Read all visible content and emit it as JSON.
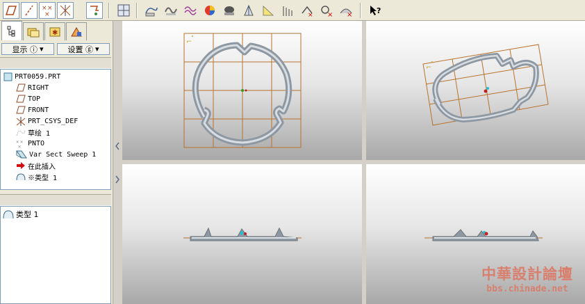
{
  "toolbar": {
    "icons": [
      "datum-plane-toggle-icon",
      "datum-axis-toggle-icon",
      "datum-point-toggle-icon",
      "csys-toggle-icon",
      "annotation-toggle-icon",
      "view-manager-icon",
      "sketch-icon",
      "style-icon",
      "curve-icon",
      "appearance-icon",
      "shading-icon",
      "draft-icon",
      "ruler-icon",
      "cross-section-icon",
      "measure-icon",
      "analysis-icon",
      "whats-this-icon"
    ]
  },
  "left_panel": {
    "show_menu": "显示 ⓘ",
    "settings_menu": "设置 ⓖ",
    "tree": [
      {
        "label": "PRT0059.PRT",
        "icon": "part-icon",
        "indent": 0
      },
      {
        "label": "RIGHT",
        "icon": "datum-plane-icon",
        "indent": 1
      },
      {
        "label": "TOP",
        "icon": "datum-plane-icon",
        "indent": 1
      },
      {
        "label": "FRONT",
        "icon": "datum-plane-icon",
        "indent": 1
      },
      {
        "label": "PRT_CSYS_DEF",
        "icon": "csys-icon",
        "indent": 1
      },
      {
        "label": "草绘 1",
        "icon": "sketch-icon",
        "indent": 1
      },
      {
        "label": "PNTO",
        "icon": "datum-point-icon",
        "indent": 1
      },
      {
        "label": "Var Sect Sweep 1",
        "icon": "sweep-icon",
        "indent": 1
      },
      {
        "label": "在此插入",
        "icon": "insert-arrow-icon",
        "indent": 1
      },
      {
        "label": "※类型 1",
        "icon": "surface-icon",
        "indent": 1
      }
    ],
    "layer_item": "类型 1"
  },
  "watermark": {
    "title": "中華設計論壇",
    "url": "bbs.chinade.net"
  },
  "colors": {
    "grid": "#b8722c",
    "model": "#9ea6ae"
  }
}
